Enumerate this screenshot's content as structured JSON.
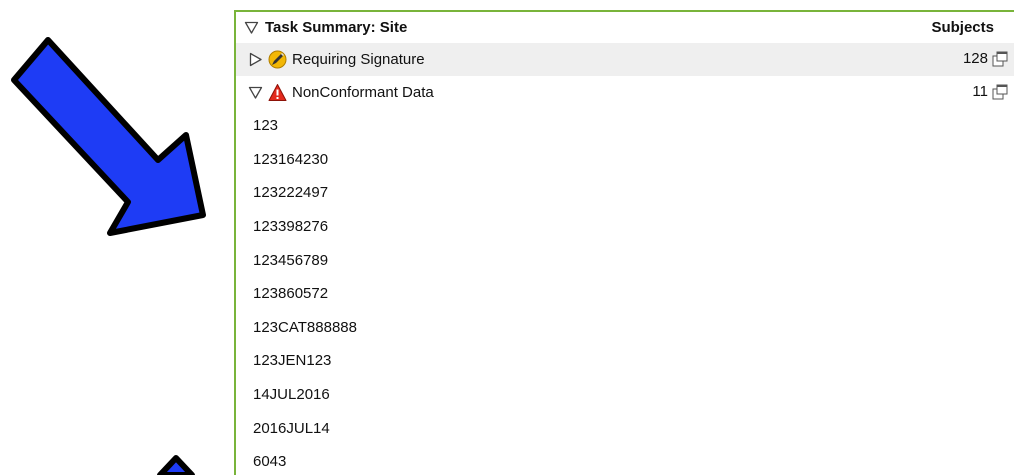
{
  "panel": {
    "title": "Task Summary: Site",
    "column_header": "Subjects",
    "border_color": "#79b43a"
  },
  "annotation": {
    "icon": "blue-arrow-icon",
    "fill_color": "#1e3cf5"
  },
  "groups": [
    {
      "label": "Requiring Signature",
      "count": "128",
      "expanded": false,
      "icon": "signature-pen-icon"
    },
    {
      "label": "NonConformant Data",
      "count": "11",
      "expanded": true,
      "icon": "warning-icon"
    }
  ],
  "subjects": [
    "123",
    "123164230",
    "123222497",
    "123398276",
    "123456789",
    "123860572",
    "123CAT888888",
    "123JEN123",
    "14JUL2016",
    "2016JUL14",
    "6043"
  ]
}
